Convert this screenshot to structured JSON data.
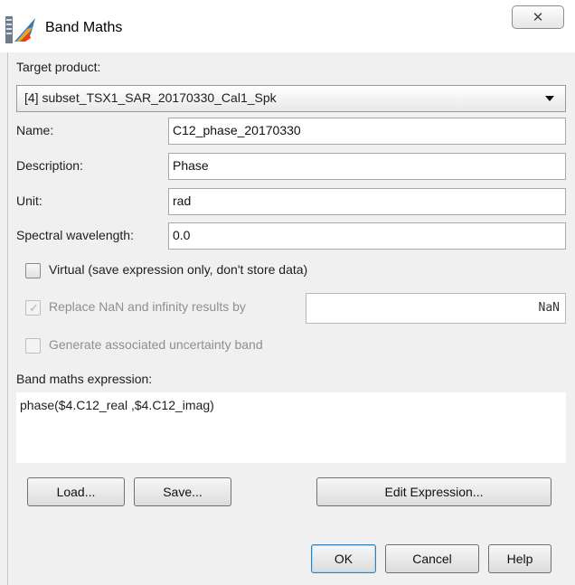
{
  "window": {
    "title": "Band Maths",
    "close_glyph": "✕"
  },
  "target_product": {
    "label": "Target product:",
    "selected": "[4] subset_TSX1_SAR_20170330_Cal1_Spk"
  },
  "fields": {
    "name": {
      "label": "Name:",
      "value": "C12_phase_20170330"
    },
    "description": {
      "label": "Description:",
      "value": "Phase"
    },
    "unit": {
      "label": "Unit:",
      "value": "rad"
    },
    "wavelength": {
      "label": "Spectral wavelength:",
      "value": "0.0"
    }
  },
  "options": {
    "virtual": {
      "label": "Virtual (save expression only, don't store data)",
      "checked": false
    },
    "replace_nan": {
      "label": "Replace NaN and infinity results by",
      "checked": true,
      "enabled": false,
      "value": "NaN"
    },
    "uncertainty": {
      "label": "Generate associated uncertainty band",
      "checked": false,
      "enabled": false
    }
  },
  "expression": {
    "label": "Band maths expression:",
    "value": "phase($4.C12_real ,$4.C12_imag)"
  },
  "buttons": {
    "load": "Load...",
    "save": "Save...",
    "edit_expression": "Edit Expression...",
    "ok": "OK",
    "cancel": "Cancel",
    "help": "Help"
  },
  "icons": {
    "app": "snap-app-icon",
    "close": "close-icon",
    "dropdown": "chevron-down-icon",
    "check": "check-icon"
  }
}
